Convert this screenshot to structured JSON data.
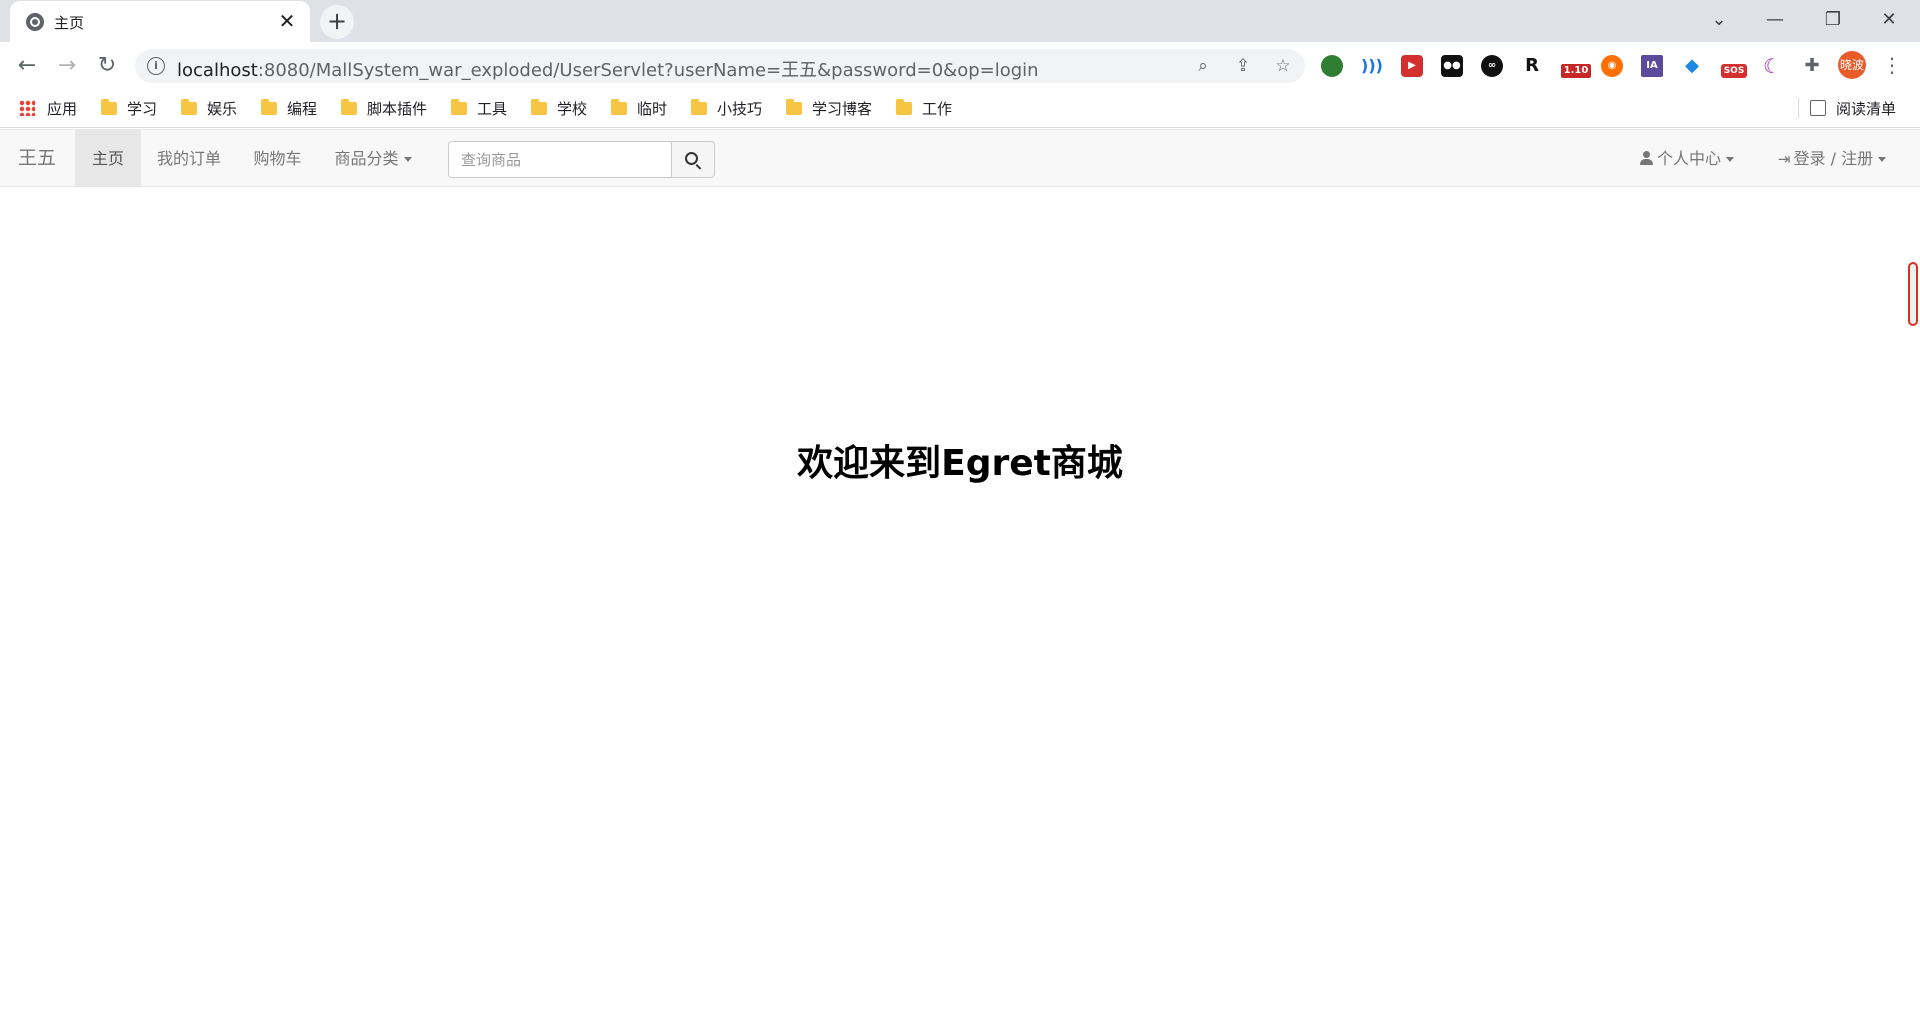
{
  "browser": {
    "tab_title": "主页",
    "tab_close": "✕",
    "new_tab": "+",
    "url_host": "localhost",
    "url_rest": ":8080/MallSystem_war_exploded/UserServlet?userName=王五&password=0&op=login",
    "profile_label": "晓波",
    "extension_badge": "1.10",
    "sos_badge": "SOS",
    "ia_badge": "IA",
    "window_controls": {
      "chevron": "⌄",
      "minimize": "—",
      "restore": "❐",
      "close": "✕"
    }
  },
  "bookmarks": {
    "apps": "应用",
    "items": [
      "学习",
      "娱乐",
      "编程",
      "脚本插件",
      "工具",
      "学校",
      "临时",
      "小技巧",
      "学习博客",
      "工作"
    ],
    "reading_list": "阅读清单"
  },
  "navbar": {
    "brand": "王五",
    "items": [
      "主页",
      "我的订单",
      "购物车",
      "商品分类"
    ],
    "search_placeholder": "查询商品",
    "user_center": "个人中心",
    "login_register": "登录 / 注册"
  },
  "main": {
    "welcome": "欢迎来到Egret商城"
  },
  "colors": {
    "navbar_bg": "#f8f8f8",
    "active_item_bg": "#e7e7e7",
    "folder": "#f6c544",
    "profile": "#ea5b2a"
  }
}
